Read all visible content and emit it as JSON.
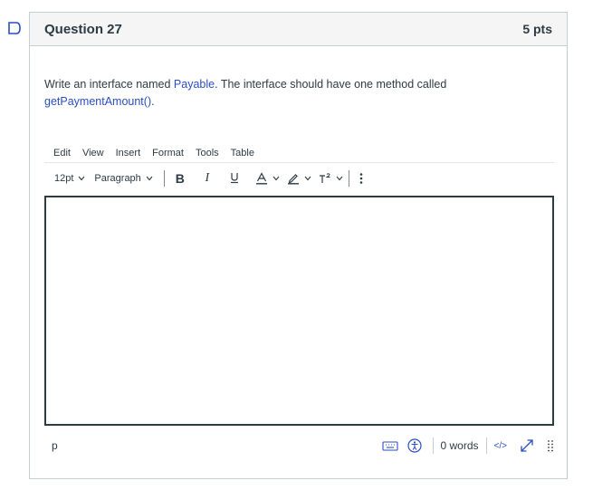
{
  "question": {
    "title": "Question 27",
    "points": "5 pts",
    "text_before": "Write an interface named ",
    "text_code1": "Payable",
    "text_middle": ".  The interface should have one method called ",
    "text_code2": "getPaymentAmount()",
    "text_after": "."
  },
  "editor": {
    "menus": [
      "Edit",
      "View",
      "Insert",
      "Format",
      "Tools",
      "Table"
    ],
    "font_size": "12pt",
    "block_format": "Paragraph",
    "status_path": "p",
    "word_count": "0 words",
    "html_toggle": "</>",
    "content": ""
  },
  "colors": {
    "link": "#2b4ec2",
    "border": "#c7cdd1",
    "text": "#2d3b45"
  },
  "icons": [
    "flag-icon",
    "bold-icon",
    "italic-icon",
    "underline-icon",
    "text-color-icon",
    "highlight-icon",
    "superscript-icon",
    "more-icon",
    "keyboard-icon",
    "accessibility-icon",
    "fullscreen-icon",
    "resize-handle-icon"
  ]
}
